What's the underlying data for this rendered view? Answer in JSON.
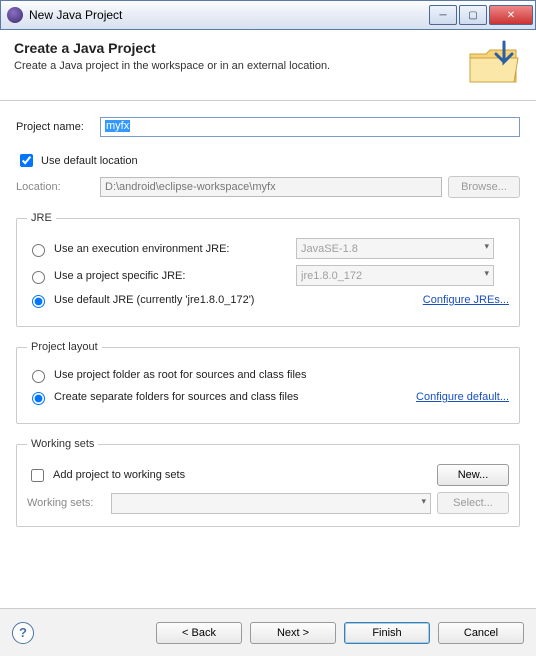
{
  "window": {
    "title": "New Java Project"
  },
  "header": {
    "title": "Create a Java Project",
    "subtitle": "Create a Java project in the workspace or in an external location."
  },
  "form": {
    "projectNameLabel": "Project name:",
    "projectNameValue": "myfx",
    "useDefaultLocationLabel": "Use default location",
    "locationLabel": "Location:",
    "locationValue": "D:\\android\\eclipse-workspace\\myfx",
    "browseLabel": "Browse..."
  },
  "jre": {
    "legend": "JRE",
    "opt1": "Use an execution environment JRE:",
    "opt1Value": "JavaSE-1.8",
    "opt2": "Use a project specific JRE:",
    "opt2Value": "jre1.8.0_172",
    "opt3": "Use default JRE (currently 'jre1.8.0_172')",
    "configureLink": "Configure JREs..."
  },
  "layout": {
    "legend": "Project layout",
    "opt1": "Use project folder as root for sources and class files",
    "opt2": "Create separate folders for sources and class files",
    "configureLink": "Configure default..."
  },
  "workingSets": {
    "legend": "Working sets",
    "addLabel": "Add project to working sets",
    "newLabel": "New...",
    "wsLabel": "Working sets:",
    "selectLabel": "Select..."
  },
  "footer": {
    "back": "< Back",
    "next": "Next >",
    "finish": "Finish",
    "cancel": "Cancel"
  }
}
